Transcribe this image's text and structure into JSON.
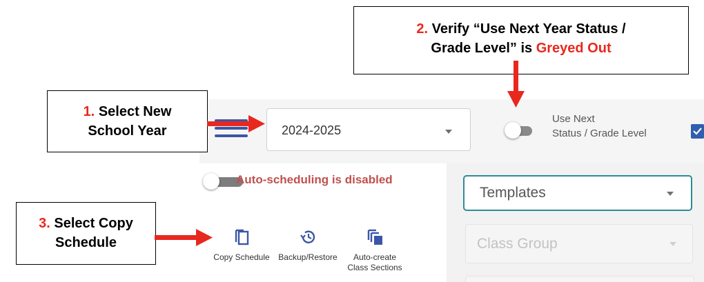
{
  "app": {
    "school_year": "2024-2025",
    "next_year_toggle_label_line1": "Use Next",
    "next_year_toggle_label_line2": "Status / Grade Level",
    "auto_scheduling_message": "Auto-scheduling is disabled",
    "tools": [
      {
        "label": "Copy Schedule",
        "icon": "copy-icon"
      },
      {
        "label": "Backup/Restore",
        "icon": "history-icon"
      },
      {
        "label_line1": "Auto-create",
        "label_line2": "Class Sections",
        "icon": "stacked-copy-icon"
      }
    ],
    "templates_select": "Templates",
    "class_group_select": "Class Group"
  },
  "annotations": {
    "step1_number": "1.",
    "step1_line1": "Select New",
    "step1_line2": "School Year",
    "step2_number": "2.",
    "step2_line1": "Verify “Use Next Year Status /",
    "step2_line2a": "Grade Level” is ",
    "step2_line2b": "Greyed Out",
    "step3_number": "3.",
    "step3_line1": "Select Copy",
    "step3_line2": "Schedule"
  },
  "colors": {
    "annotation_accent": "#e8281e",
    "hamburger": "#3b56a6",
    "auto_msg": "#c0504d",
    "templates_border": "#2c8b94",
    "checkbox": "#2f5fae"
  }
}
